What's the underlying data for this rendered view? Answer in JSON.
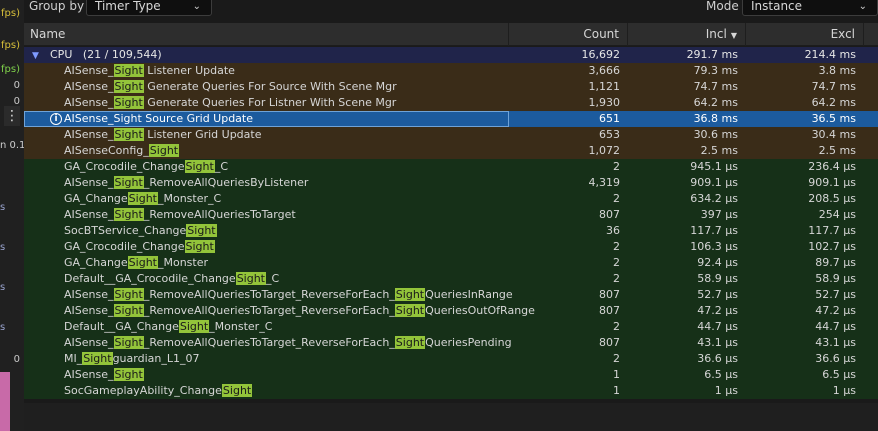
{
  "left_strip": {
    "fps1": "fps)",
    "fps2": "fps)",
    "fps3": "fps)",
    "zero1": "0",
    "zero2": "0",
    "menu": "⋮",
    "label": "n 0.1",
    "s_marks": [
      "s",
      "s",
      "s",
      "s",
      "s"
    ],
    "zero3": "0"
  },
  "toolbar": {
    "group_by_label": "Group by",
    "group_by_value": "Timer Type",
    "mode_label": "Mode",
    "mode_value": "Instance"
  },
  "columns": {
    "name": "Name",
    "count": "Count",
    "incl": "Incl",
    "excl": "Excl"
  },
  "cpu_row": {
    "label": "CPU",
    "detail": "(21 / 109,544)",
    "count": "16,692",
    "incl": "291.7 ms",
    "excl": "214.4 ms"
  },
  "highlight_term": "Sight",
  "rows": [
    {
      "parts": [
        "AISense_",
        "Sight",
        " Listener Update"
      ],
      "count": "3,666",
      "incl": "79.3 ms",
      "excl": "3.8 ms",
      "style": "brown"
    },
    {
      "parts": [
        "AISense_",
        "Sight",
        " Generate Queries For Source With Scene Mgr"
      ],
      "count": "1,121",
      "incl": "74.7 ms",
      "excl": "74.7 ms",
      "style": "brown"
    },
    {
      "parts": [
        "AISense_",
        "Sight",
        " Generate Queries For Listner With Scene Mgr"
      ],
      "count": "1,930",
      "incl": "64.2 ms",
      "excl": "64.2 ms",
      "style": "brown"
    },
    {
      "parts": [
        "AISense_",
        "Sight",
        " Source Grid Update"
      ],
      "count": "651",
      "incl": "36.8 ms",
      "excl": "36.5 ms",
      "style": "selected"
    },
    {
      "parts": [
        "AISense_",
        "Sight",
        " Listener Grid Update"
      ],
      "count": "653",
      "incl": "30.6 ms",
      "excl": "30.4 ms",
      "style": "brown"
    },
    {
      "parts": [
        "AISenseConfig_",
        "Sight",
        ""
      ],
      "count": "1,072",
      "incl": "2.5 ms",
      "excl": "2.5 ms",
      "style": "brown"
    },
    {
      "parts": [
        "GA_Crocodile_Change",
        "Sight",
        "_C"
      ],
      "count": "2",
      "incl": "945.1 μs",
      "excl": "236.4 μs",
      "style": "green"
    },
    {
      "parts": [
        "AISense_",
        "Sight",
        "_RemoveAllQueriesByListener"
      ],
      "count": "4,319",
      "incl": "909.1 μs",
      "excl": "909.1 μs",
      "style": "green"
    },
    {
      "parts": [
        "GA_Change",
        "Sight",
        "_Monster_C"
      ],
      "count": "2",
      "incl": "634.2 μs",
      "excl": "208.5 μs",
      "style": "green"
    },
    {
      "parts": [
        "AISense_",
        "Sight",
        "_RemoveAllQueriesToTarget"
      ],
      "count": "807",
      "incl": "397 μs",
      "excl": "254 μs",
      "style": "green"
    },
    {
      "parts": [
        "SocBTService_Change",
        "Sight",
        ""
      ],
      "count": "36",
      "incl": "117.7 μs",
      "excl": "117.7 μs",
      "style": "green"
    },
    {
      "parts": [
        "GA_Crocodile_Change",
        "Sight",
        ""
      ],
      "count": "2",
      "incl": "106.3 μs",
      "excl": "102.7 μs",
      "style": "green"
    },
    {
      "parts": [
        "GA_Change",
        "Sight",
        "_Monster"
      ],
      "count": "2",
      "incl": "92.4 μs",
      "excl": "89.7 μs",
      "style": "green"
    },
    {
      "parts": [
        "Default__GA_Crocodile_Change",
        "Sight",
        "_C"
      ],
      "count": "2",
      "incl": "58.9 μs",
      "excl": "58.9 μs",
      "style": "green"
    },
    {
      "parts": [
        "AISense_",
        "Sight",
        "_RemoveAllQueriesToTarget_ReverseForEach_",
        "Sight",
        "QueriesInRange"
      ],
      "count": "807",
      "incl": "52.7 μs",
      "excl": "52.7 μs",
      "style": "green"
    },
    {
      "parts": [
        "AISense_",
        "Sight",
        "_RemoveAllQueriesToTarget_ReverseForEach_",
        "Sight",
        "QueriesOutOfRange"
      ],
      "count": "807",
      "incl": "47.2 μs",
      "excl": "47.2 μs",
      "style": "green"
    },
    {
      "parts": [
        "Default__GA_Change",
        "Sight",
        "_Monster_C"
      ],
      "count": "2",
      "incl": "44.7 μs",
      "excl": "44.7 μs",
      "style": "green"
    },
    {
      "parts": [
        "AISense_",
        "Sight",
        "_RemoveAllQueriesToTarget_ReverseForEach_",
        "Sight",
        "QueriesPending"
      ],
      "count": "807",
      "incl": "43.1 μs",
      "excl": "43.1 μs",
      "style": "green"
    },
    {
      "parts": [
        "MI_",
        "Sight",
        "guardian_L1_07"
      ],
      "count": "2",
      "incl": "36.6 μs",
      "excl": "36.6 μs",
      "style": "green"
    },
    {
      "parts": [
        "AISense_",
        "Sight",
        ""
      ],
      "count": "1",
      "incl": "6.5 μs",
      "excl": "6.5 μs",
      "style": "green"
    },
    {
      "parts": [
        "SocGameplayAbility_Change",
        "Sight",
        ""
      ],
      "count": "1",
      "incl": "1 μs",
      "excl": "1 μs",
      "style": "green"
    }
  ]
}
